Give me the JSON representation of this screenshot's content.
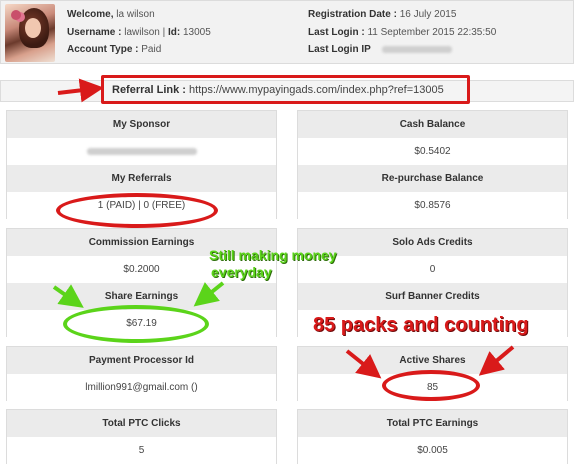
{
  "header": {
    "welcome_label": "Welcome,",
    "welcome_name": "la wilson",
    "username_label": "Username :",
    "username_value": "lawilson",
    "id_label": "Id:",
    "id_value": "13005",
    "account_type_label": "Account Type :",
    "account_type_value": "Paid",
    "registration_label": "Registration Date :",
    "registration_value": "16 July 2015",
    "last_login_label": "Last Login :",
    "last_login_value": "11 September 2015 22:35:50",
    "last_login_ip_label": "Last Login IP"
  },
  "referral": {
    "label": "Referral Link :",
    "url": "https://www.mypayingads.com/index.php?ref=13005"
  },
  "left": {
    "my_sponsor": "My Sponsor",
    "my_referrals": "My Referrals",
    "my_referrals_value": "1 (PAID) | 0 (FREE)",
    "commission_earnings": "Commission Earnings",
    "commission_earnings_value": "$0.2000",
    "share_earnings": "Share Earnings",
    "share_earnings_value": "$67.19",
    "payment_processor_id": "Payment Processor Id",
    "payment_processor_value": "lmillion991@gmail.com ()",
    "total_ptc_clicks": "Total PTC Clicks",
    "total_ptc_clicks_value": "5"
  },
  "right": {
    "cash_balance": "Cash Balance",
    "cash_balance_value": "$0.5402",
    "repurchase_balance": "Re-purchase Balance",
    "repurchase_balance_value": "$0.8576",
    "solo_ads_credits": "Solo Ads Credits",
    "solo_ads_credits_value": "0",
    "surf_banner_credits": "Surf Banner Credits",
    "active_shares": "Active Shares",
    "active_shares_value": "85",
    "total_ptc_earnings": "Total PTC Earnings",
    "total_ptc_earnings_value": "$0.005"
  },
  "annotations": {
    "green_line1": "Still making money",
    "green_line2": "everyday",
    "red_text": "85 packs and counting"
  },
  "colors": {
    "annotation_red": "#d91a1a",
    "annotation_green": "#5bd41a",
    "header_bg": "#ebebeb"
  }
}
